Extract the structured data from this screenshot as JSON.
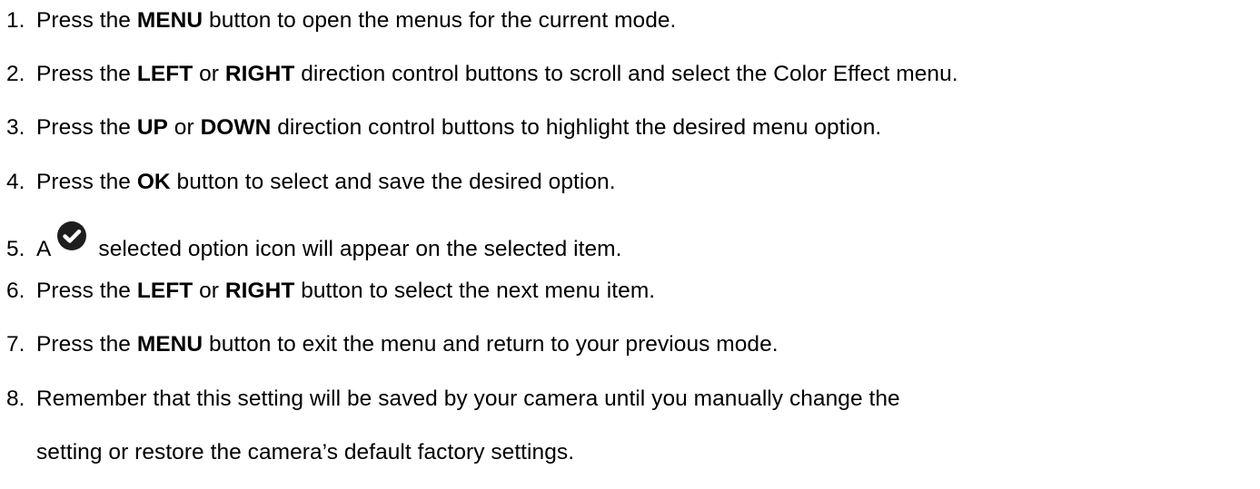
{
  "steps": [
    {
      "num": "1.",
      "pre": "Press the ",
      "key": "MENU",
      "post": " button to open the menus for the current mode."
    },
    {
      "num": "2.",
      "pre": "Press the ",
      "key": "LEFT",
      "mid": " or ",
      "key2": "RIGHT",
      "post": " direction control buttons to scroll and select the Color Effect menu."
    },
    {
      "num": "3.",
      "pre": "Press the ",
      "key": "UP",
      "mid": " or ",
      "key2": "DOWN",
      "post": " direction control buttons to highlight the desired menu option."
    },
    {
      "num": "4.",
      "pre": "Press the ",
      "key": "OK",
      "post": " button to select and save the desired option."
    },
    {
      "num": "5.",
      "pre": "A",
      "post": "selected option icon will appear on the selected item.",
      "icon": "check-circle-icon"
    },
    {
      "num": "6.",
      "pre": "Press the ",
      "key": "LEFT",
      "mid": " or ",
      "key2": "RIGHT",
      "post": " button to select the next menu item."
    },
    {
      "num": "7.",
      "pre": "Press the ",
      "key": "MENU",
      "post": " button to exit the menu and return to your previous mode."
    },
    {
      "num": "8.",
      "line1": "Remember that this setting will be saved by your camera until you manually change the",
      "line2": "setting or restore the camera’s default factory settings."
    }
  ]
}
